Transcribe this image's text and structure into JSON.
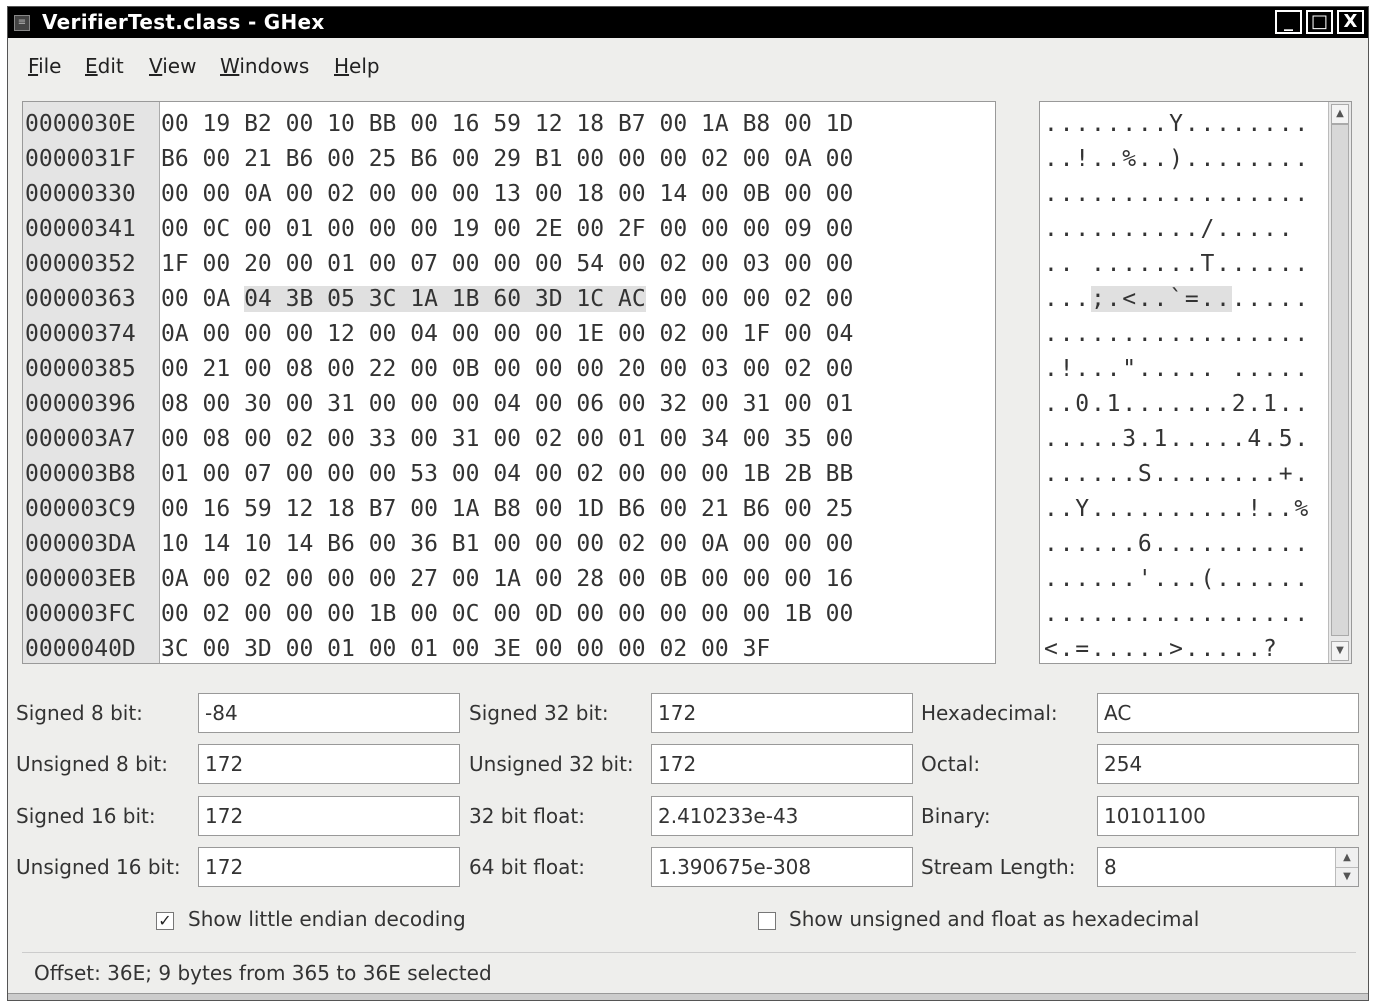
{
  "window": {
    "title": "VerifierTest.class - GHex",
    "min_glyph": "_",
    "max_glyph": "□",
    "close_glyph": "X"
  },
  "menu": [
    {
      "key": "F",
      "rest": "ile"
    },
    {
      "key": "E",
      "rest": "dit"
    },
    {
      "key": "V",
      "rest": "iew"
    },
    {
      "key": "W",
      "rest": "indows"
    },
    {
      "key": "H",
      "rest": "elp"
    }
  ],
  "hex_rows": [
    {
      "addr": "0000030E",
      "hex": "00 19 B2 00 10 BB 00 16 59 12 18 B7 00 1A B8 00 1D",
      "ascii": "........Y........"
    },
    {
      "addr": "0000031F",
      "hex": "B6 00 21 B6 00 25 B6 00 29 B1 00 00 00 02 00 0A 00",
      "ascii": "..!..%..)........"
    },
    {
      "addr": "00000330",
      "hex": "00 00 0A 00 02 00 00 00 13 00 18 00 14 00 0B 00 00",
      "ascii": "................."
    },
    {
      "addr": "00000341",
      "hex": "00 0C 00 01 00 00 00 19 00 2E 00 2F 00 00 00 09 00",
      "ascii": "........../....."
    },
    {
      "addr": "00000352",
      "hex": "1F 00 20 00 01 00 07 00 00 00 54 00 02 00 03 00 00",
      "ascii": ".. .......T......"
    },
    {
      "addr": "00000363",
      "hex_pre": "00 0A ",
      "hex_sel": "04 3B 05 3C 1A 1B 60 3D 1C AC",
      "hex_post": " 00 00 00 02 00",
      "ascii_pre": "...",
      "ascii_sel": ";.<..`=..",
      "ascii_post": "....."
    },
    {
      "addr": "00000374",
      "hex": "0A 00 00 00 12 00 04 00 00 00 1E 00 02 00 1F 00 04",
      "ascii": "................."
    },
    {
      "addr": "00000385",
      "hex": "00 21 00 08 00 22 00 0B 00 00 00 20 00 03 00 02 00",
      "ascii": ".!...\"..... ....."
    },
    {
      "addr": "00000396",
      "hex": "08 00 30 00 31 00 00 00 04 00 06 00 32 00 31 00 01",
      "ascii": "..0.1.......2.1.."
    },
    {
      "addr": "000003A7",
      "hex": "00 08 00 02 00 33 00 31 00 02 00 01 00 34 00 35 00",
      "ascii": ".....3.1.....4.5."
    },
    {
      "addr": "000003B8",
      "hex": "01 00 07 00 00 00 53 00 04 00 02 00 00 00 1B 2B BB",
      "ascii": "......S........+."
    },
    {
      "addr": "000003C9",
      "hex": "00 16 59 12 18 B7 00 1A B8 00 1D B6 00 21 B6 00 25",
      "ascii": "..Y..........!..%"
    },
    {
      "addr": "000003DA",
      "hex": "10 14 10 14 B6 00 36 B1 00 00 00 02 00 0A 00 00 00",
      "ascii": "......6.........."
    },
    {
      "addr": "000003EB",
      "hex": "0A 00 02 00 00 00 27 00 1A 00 28 00 0B 00 00 00 16",
      "ascii": "......'...(......"
    },
    {
      "addr": "000003FC",
      "hex": "00 02 00 00 00 1B 00 0C 00 0D 00 00 00 00 00 1B 00",
      "ascii": "................."
    },
    {
      "addr": "0000040D",
      "hex": "3C 00 3D 00 01 00 01 00 3E 00 00 00 02 00 3F",
      "ascii": "<.=.....>.....?"
    }
  ],
  "fields": {
    "signed8_label": "Signed 8 bit:",
    "signed8": "-84",
    "unsigned8_label": "Unsigned 8 bit:",
    "unsigned8": "172",
    "signed16_label": "Signed 16 bit:",
    "signed16": "172",
    "unsigned16_label": "Unsigned 16 bit:",
    "unsigned16": "172",
    "signed32_label": "Signed 32 bit:",
    "signed32": "172",
    "unsigned32_label": "Unsigned 32 bit:",
    "unsigned32": "172",
    "float32_label": "32 bit float:",
    "float32": "2.410233e-43",
    "float64_label": "64 bit float:",
    "float64": "1.390675e-308",
    "hex_label": "Hexadecimal:",
    "hex": "AC",
    "octal_label": "Octal:",
    "octal": "254",
    "binary_label": "Binary:",
    "binary": "10101100",
    "stream_label": "Stream Length:",
    "stream": "8"
  },
  "checkboxes": {
    "little_endian": {
      "label": "Show little endian decoding",
      "checked": true,
      "mark": "✓"
    },
    "unsigned_hex": {
      "label": "Show unsigned and float as hexadecimal",
      "checked": false,
      "mark": ""
    }
  },
  "status": "Offset: 36E; 9 bytes from 365 to 36E selected"
}
